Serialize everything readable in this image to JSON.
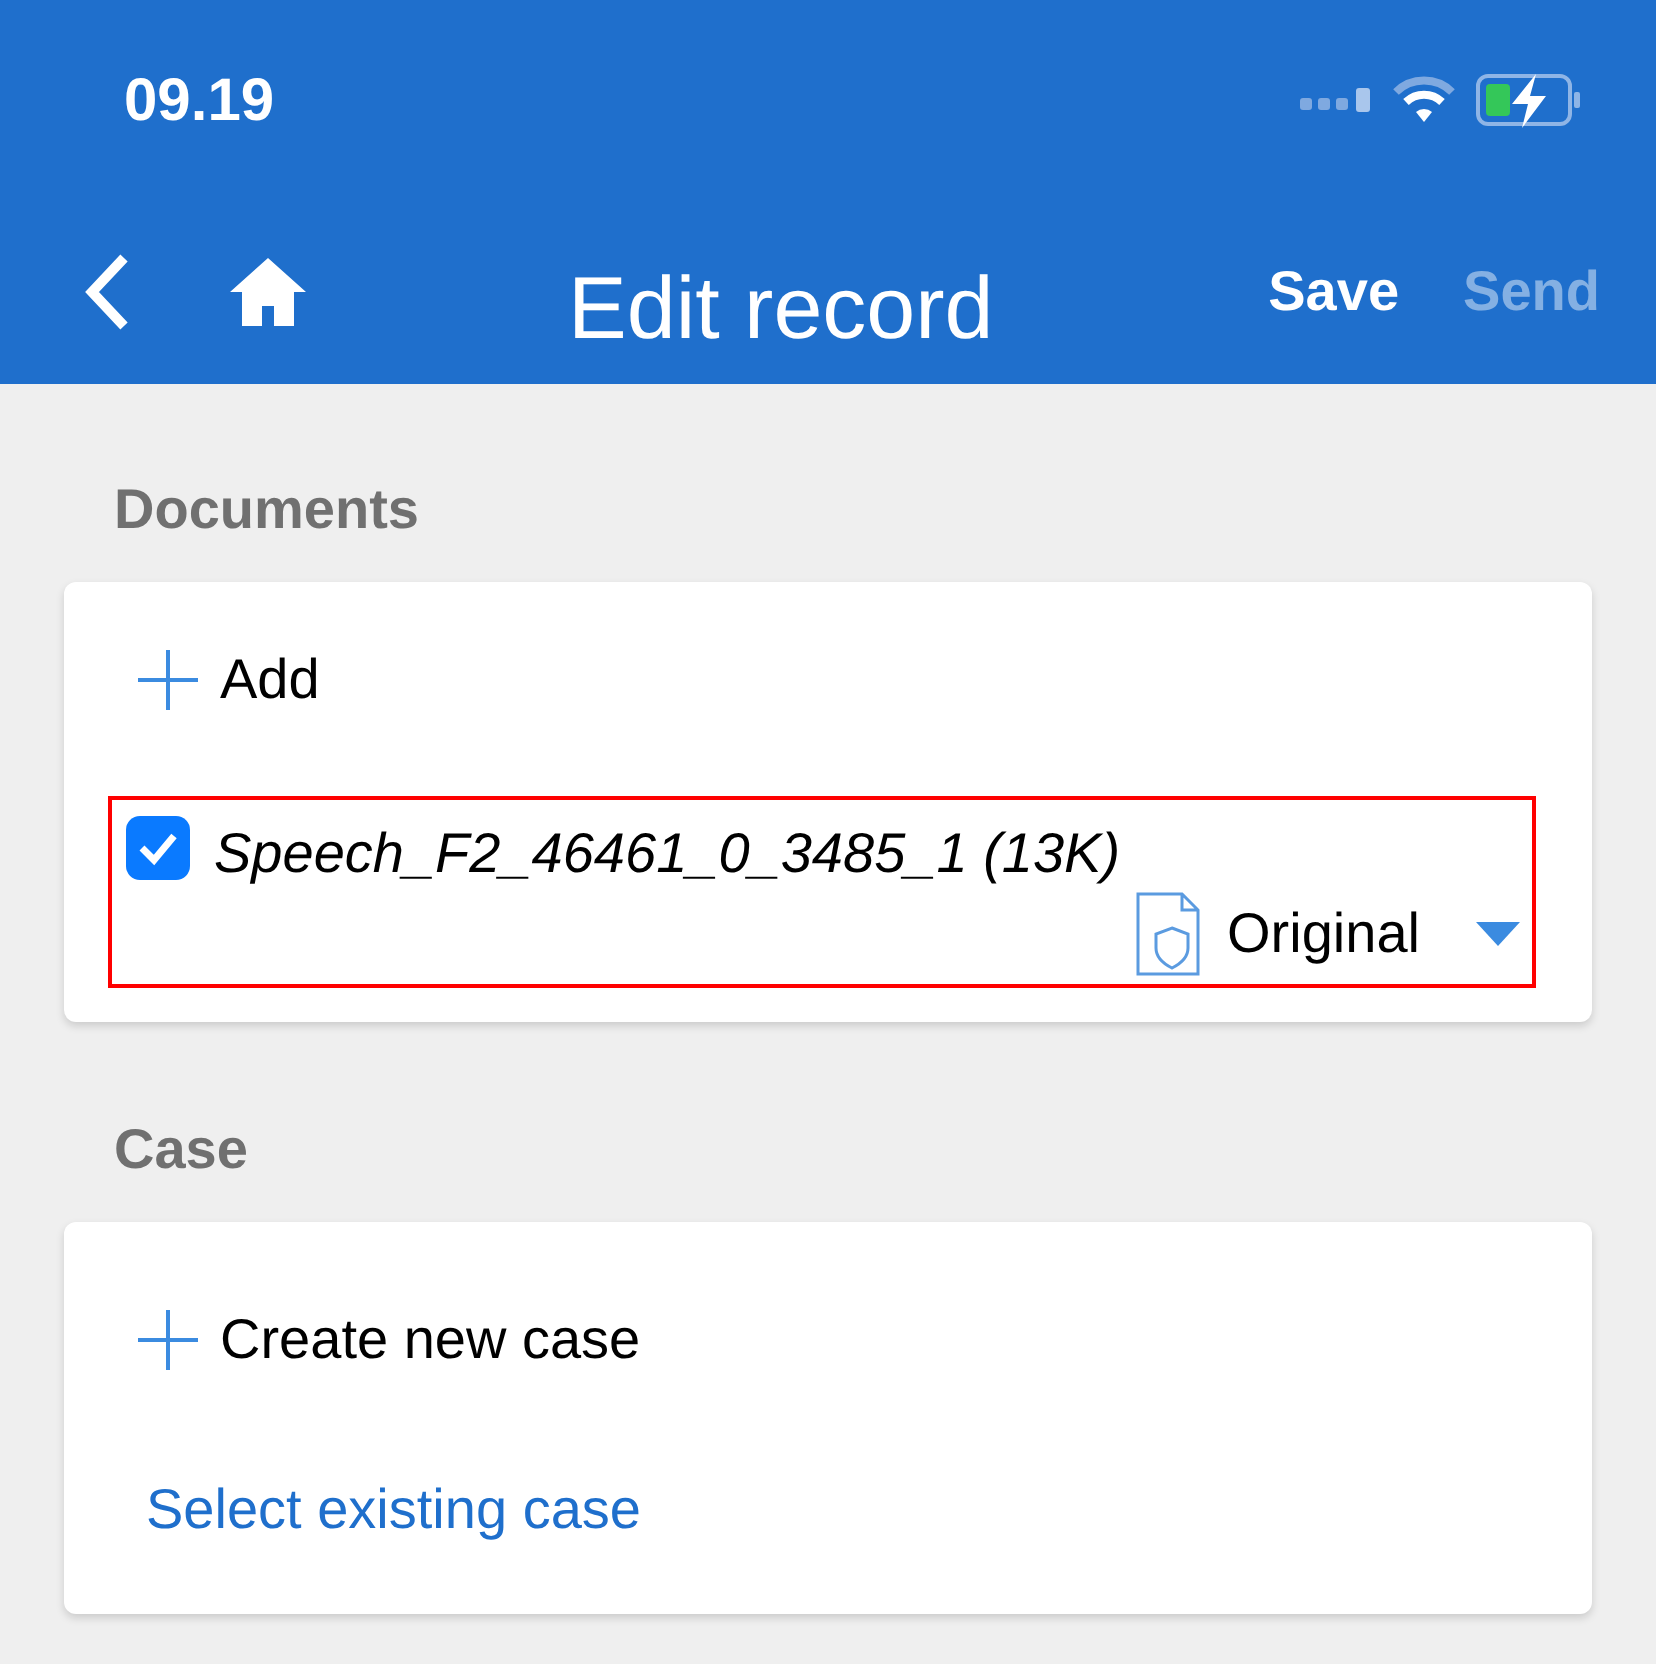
{
  "status_bar": {
    "time": "09.19"
  },
  "nav": {
    "title": "Edit record",
    "actions": [
      {
        "label": "Save",
        "disabled": false
      },
      {
        "label": "Send",
        "disabled": true
      }
    ]
  },
  "documents": {
    "heading": "Documents",
    "add_label": "Add",
    "files": [
      {
        "name": "Speech_F2_46461_0_3485_1 (13K)",
        "checked": true,
        "selected": true,
        "version": "Original"
      }
    ]
  },
  "case": {
    "heading": "Case",
    "create_label": "Create new case",
    "select_link": "Select existing case"
  }
}
